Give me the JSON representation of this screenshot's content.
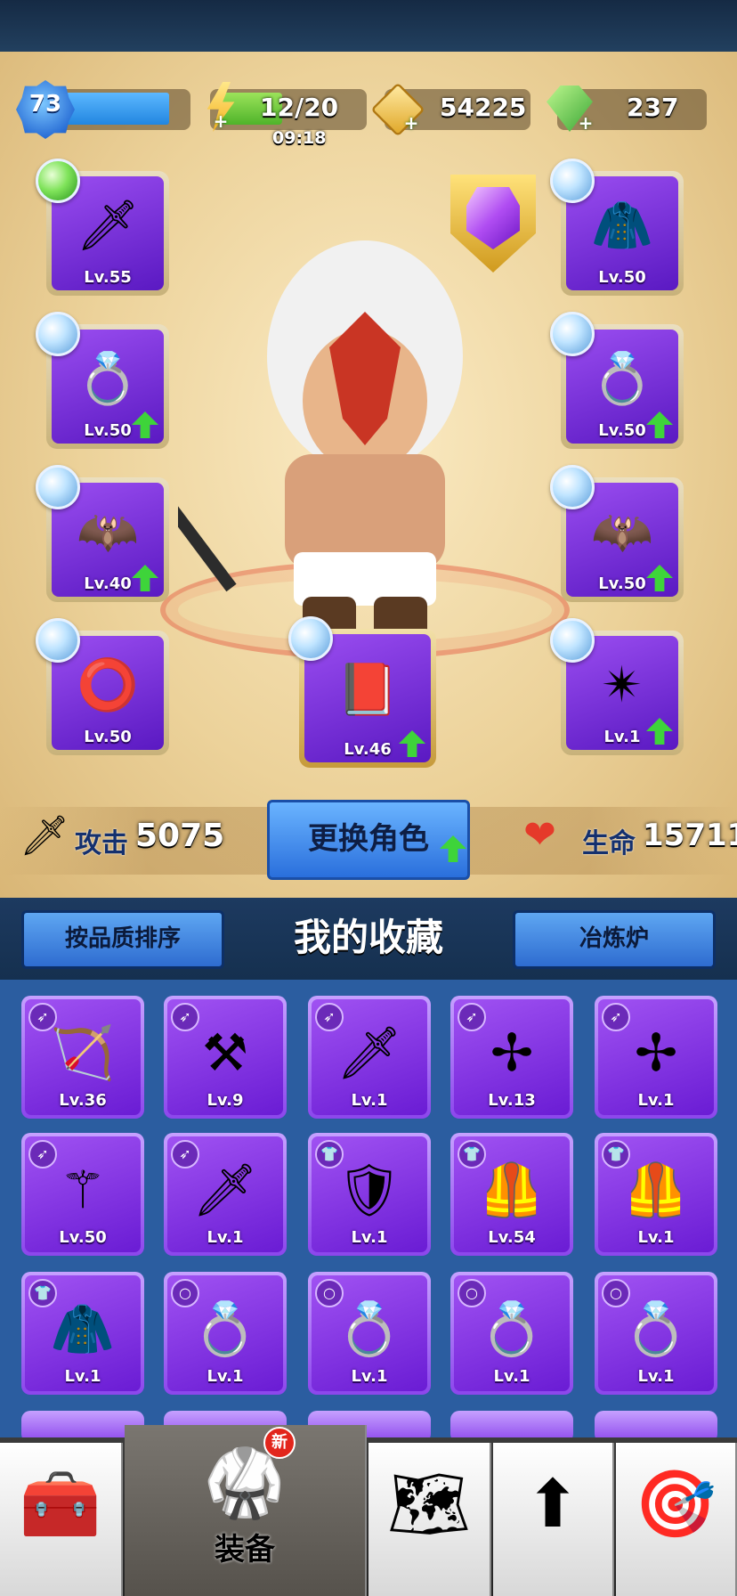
{
  "player": {
    "level": "73"
  },
  "resources": {
    "energy": {
      "value": "12/20",
      "timer": "09:18",
      "fill": 0.6
    },
    "gold": "54225",
    "gems": "237"
  },
  "equipment": [
    {
      "name": "sword",
      "level": "Lv.55",
      "orb": "green",
      "icon": "sword-icon",
      "glyph": "🗡",
      "upgrade": false
    },
    {
      "name": "armor",
      "level": "Lv.50",
      "orb": "blue",
      "icon": "armor-icon",
      "glyph": "🧥",
      "upgrade": false
    },
    {
      "name": "ring-left",
      "level": "Lv.50",
      "orb": "blue",
      "icon": "lion-ring-icon",
      "glyph": "💍",
      "upgrade": true
    },
    {
      "name": "ring-right",
      "level": "Lv.50",
      "orb": "blue",
      "icon": "lion-ring-icon",
      "glyph": "💍",
      "upgrade": true
    },
    {
      "name": "pet-left",
      "level": "Lv.40",
      "orb": "blue",
      "icon": "bat-pet-icon",
      "glyph": "🦇",
      "upgrade": true
    },
    {
      "name": "pet-right",
      "level": "Lv.50",
      "orb": "blue",
      "icon": "bat-pet-icon",
      "glyph": "🦇",
      "upgrade": true
    },
    {
      "name": "bracelet",
      "level": "Lv.50",
      "orb": "blue",
      "icon": "bracelet-icon",
      "glyph": "⭕",
      "upgrade": false
    },
    {
      "name": "book",
      "level": "Lv.46",
      "orb": "blue",
      "icon": "fire-book-icon",
      "glyph": "📕",
      "upgrade": true
    },
    {
      "name": "amulet",
      "level": "Lv.1",
      "orb": "blue",
      "icon": "amulet-icon",
      "glyph": "✴",
      "upgrade": true
    }
  ],
  "stats": {
    "attack_label": "攻击",
    "attack_value": "5075",
    "change_hero_label": "更换角色",
    "health_label": "生命",
    "health_value": "15711"
  },
  "collection": {
    "sort_button": "按品质排序",
    "title": "我的收藏",
    "furnace_button": "冶炼炉",
    "items": [
      {
        "type_icon": "bow-type-icon",
        "type_glyph": "➶",
        "icon": "bow-icon",
        "glyph": "🏹",
        "level": "Lv.36"
      },
      {
        "type_icon": "bow-type-icon",
        "type_glyph": "➶",
        "icon": "scythe-icon",
        "glyph": "⚒",
        "level": "Lv.9"
      },
      {
        "type_icon": "bow-type-icon",
        "type_glyph": "➶",
        "icon": "pink-sword-icon",
        "glyph": "🗡",
        "level": "Lv.1"
      },
      {
        "type_icon": "bow-type-icon",
        "type_glyph": "➶",
        "icon": "shuriken-icon",
        "glyph": "✢",
        "level": "Lv.13"
      },
      {
        "type_icon": "bow-type-icon",
        "type_glyph": "➶",
        "icon": "shuriken-icon",
        "glyph": "✢",
        "level": "Lv.1"
      },
      {
        "type_icon": "bow-type-icon",
        "type_glyph": "➶",
        "icon": "staff-icon",
        "glyph": "⚚",
        "level": "Lv.50"
      },
      {
        "type_icon": "bow-type-icon",
        "type_glyph": "➶",
        "icon": "sword-icon",
        "glyph": "🗡",
        "level": "Lv.1"
      },
      {
        "type_icon": "armor-type-icon",
        "type_glyph": "👕",
        "icon": "gold-armor-icon",
        "glyph": "🛡",
        "level": "Lv.1"
      },
      {
        "type_icon": "armor-type-icon",
        "type_glyph": "👕",
        "icon": "dark-vest-icon",
        "glyph": "🦺",
        "level": "Lv.54"
      },
      {
        "type_icon": "armor-type-icon",
        "type_glyph": "👕",
        "icon": "dark-vest-icon",
        "glyph": "🦺",
        "level": "Lv.1"
      },
      {
        "type_icon": "armor-type-icon",
        "type_glyph": "👕",
        "icon": "red-cloak-icon",
        "glyph": "🧥",
        "level": "Lv.1"
      },
      {
        "type_icon": "ring-type-icon",
        "type_glyph": "○",
        "icon": "wolf-ring-icon",
        "glyph": "💍",
        "level": "Lv.1"
      },
      {
        "type_icon": "ring-type-icon",
        "type_glyph": "○",
        "icon": "wolf-ring-icon",
        "glyph": "💍",
        "level": "Lv.1"
      },
      {
        "type_icon": "ring-type-icon",
        "type_glyph": "○",
        "icon": "wolf-ring-icon",
        "glyph": "💍",
        "level": "Lv.1"
      },
      {
        "type_icon": "ring-type-icon",
        "type_glyph": "○",
        "icon": "wolf-ring-icon",
        "glyph": "💍",
        "level": "Lv.1"
      }
    ]
  },
  "nav": {
    "items": [
      {
        "name": "treasure-chest",
        "icon": "treasure-chest-icon",
        "glyph": "🧰",
        "label": "",
        "active": false
      },
      {
        "name": "equipment",
        "icon": "armor-icon",
        "glyph": "🥋",
        "label": "装备",
        "active": true,
        "badge": "新"
      },
      {
        "name": "map",
        "icon": "map-icon",
        "glyph": "🗺",
        "label": "",
        "active": false
      },
      {
        "name": "upgrade",
        "icon": "upgrade-arrow-icon",
        "glyph": "⬆",
        "label": "",
        "active": false
      },
      {
        "name": "target",
        "icon": "target-icon",
        "glyph": "🎯",
        "label": "",
        "active": false
      }
    ]
  }
}
